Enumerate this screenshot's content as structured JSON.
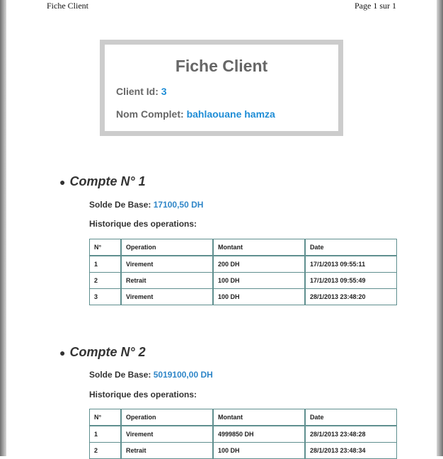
{
  "page_header": {
    "left": "Fiche Client",
    "right": "Page 1 sur 1"
  },
  "header_box": {
    "title": "Fiche Client",
    "client_id_label": "Client Id:",
    "client_id": "3",
    "full_name_label": "Nom Complet:",
    "full_name": "bahlaouane hamza"
  },
  "table_columns": [
    "N°",
    "Operation",
    "Montant",
    "Date"
  ],
  "accounts": [
    {
      "heading": "Compte N° 1",
      "balance_label": "Solde De Base:",
      "balance": "17100,50 DH",
      "history_label": "Historique des operations:",
      "rows": [
        [
          "1",
          "Virement",
          "200 DH",
          "17/1/2013 09:55:11"
        ],
        [
          "2",
          "Retrait",
          "100 DH",
          "17/1/2013 09:55:49"
        ],
        [
          "3",
          "Virement",
          "100 DH",
          "28/1/2013 23:48:20"
        ]
      ]
    },
    {
      "heading": "Compte N° 2",
      "balance_label": "Solde De Base:",
      "balance": "5019100,00 DH",
      "history_label": "Historique des operations:",
      "rows": [
        [
          "1",
          "Virement",
          "4999850 DH",
          "28/1/2013 23:48:28"
        ],
        [
          "2",
          "Retrait",
          "100 DH",
          "28/1/2013 23:48:34"
        ]
      ]
    }
  ]
}
